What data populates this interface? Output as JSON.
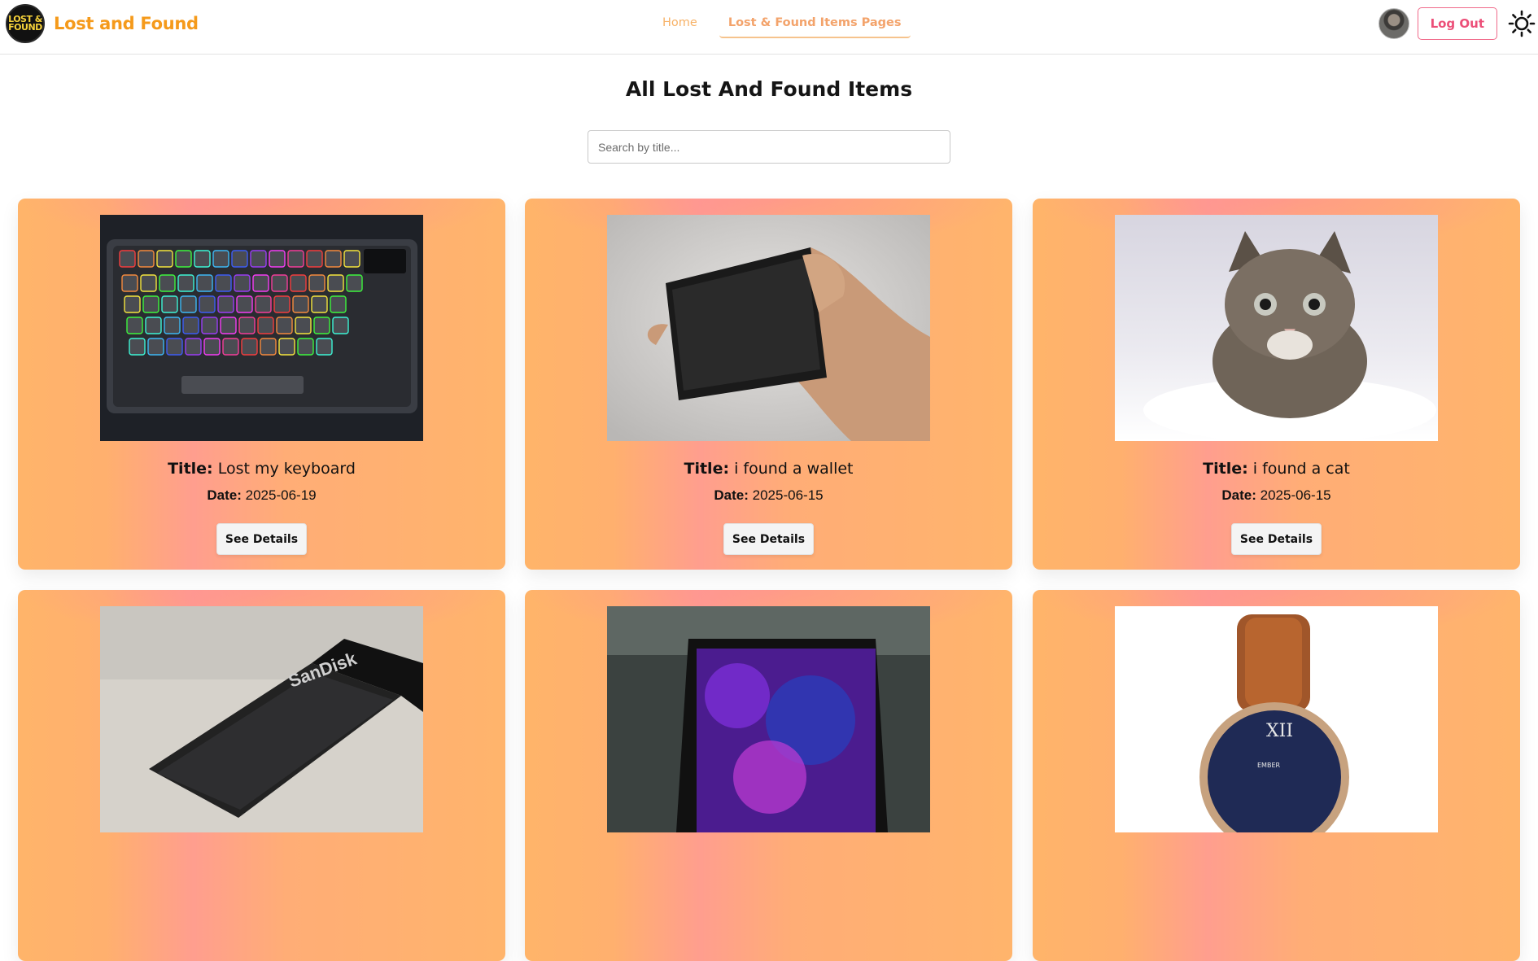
{
  "brand": {
    "logo_line1": "LOST &",
    "logo_line2": "FOUND",
    "name": "Lost and Found"
  },
  "nav": {
    "links": [
      {
        "label": "Home",
        "active": false
      },
      {
        "label": "Lost & Found Items Pages",
        "active": true
      }
    ],
    "logout_label": "Log Out",
    "theme_icon": "sun-icon"
  },
  "page": {
    "title": "All Lost And Found Items",
    "search_placeholder": "Search by title..."
  },
  "labels": {
    "title_prefix": "Title:",
    "date_prefix": "Date:",
    "details_button": "See Details"
  },
  "items": [
    {
      "title": "Lost my keyboard",
      "date": "2025-06-19",
      "image": "rgb-mechanical-keyboard"
    },
    {
      "title": "i found a wallet",
      "date": "2025-06-15",
      "image": "black-leather-wallet-in-hand"
    },
    {
      "title": "i found a cat",
      "date": "2025-06-15",
      "image": "tabby-kitten"
    },
    {
      "title": "",
      "date": "",
      "image": "sandisk-usb-drive"
    },
    {
      "title": "",
      "date": "",
      "image": "laptop-with-purple-screen"
    },
    {
      "title": "",
      "date": "",
      "image": "wrist-watch-brown-strap"
    }
  ],
  "colors": {
    "brand": "#f59a1b",
    "logout": "#ec4f78",
    "card_from": "#ffb46a",
    "card_mid": "#ff9e8e"
  }
}
